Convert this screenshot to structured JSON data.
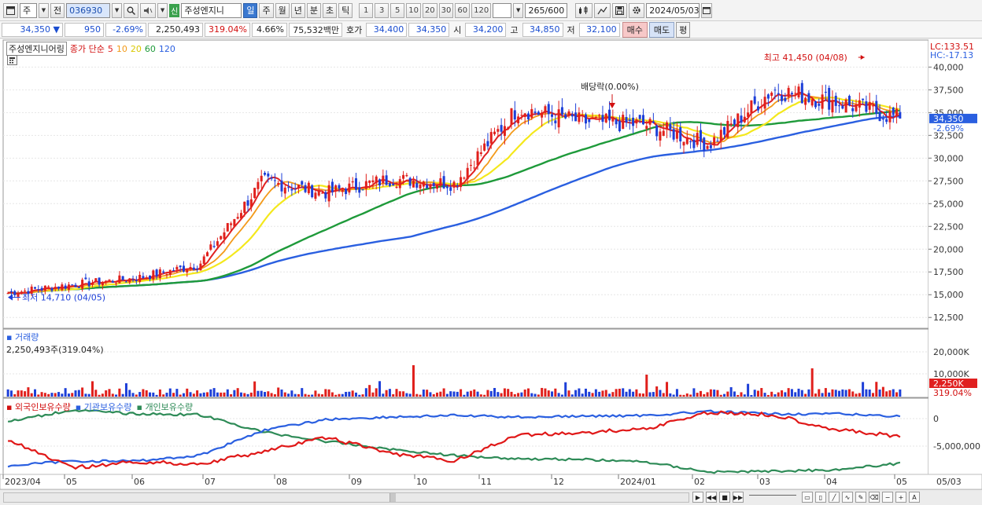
{
  "toolbar": {
    "market": "주",
    "prev": "전",
    "code": "036930",
    "badge": "신",
    "name": "주성엔지니",
    "periods": [
      "일",
      "주",
      "월",
      "년",
      "분",
      "초",
      "틱"
    ],
    "intervals": [
      "1",
      "3",
      "5",
      "10",
      "20",
      "30",
      "60",
      "120"
    ],
    "count": "265/600",
    "date": "2024/05/03"
  },
  "quote": {
    "price": "34,350 ▼",
    "change": "950",
    "change_pct": "-2.69%",
    "volume": "2,250,493",
    "volume_pct": "319.04%",
    "turnover": "4.66%",
    "amount": "75,532백만",
    "ask_label": "호가",
    "ask1": "34,400",
    "ask2": "34,350",
    "open_label": "시",
    "open": "34,200",
    "high_label": "고",
    "high": "34,850",
    "low_label": "저",
    "low": "32,100",
    "buy": "매수",
    "sell": "매도",
    "flat": "평"
  },
  "legend": {
    "name": "주성엔지니어링",
    "kind": "종가 단순",
    "ma": [
      "5",
      "10",
      "20",
      "60",
      "120"
    ]
  },
  "annotations": {
    "high": "최고 41,450 (04/08)",
    "low": "최저 14,710 (04/05)",
    "dividend": "배당락(0.00%)"
  },
  "price_axis": {
    "lc": "LC:133.51",
    "hc": "HC:-17.13",
    "ticks": [
      "40,000",
      "37,500",
      "35,000",
      "32,500",
      "30,000",
      "27,500",
      "25,000",
      "22,500",
      "20,000",
      "17,500",
      "15,000",
      "12,500"
    ],
    "current": "34,350",
    "current_pct": "-2.69%"
  },
  "volume_panel": {
    "title": "거래량",
    "value": "2,250,493주(319.04%)",
    "ticks": [
      "20,000K",
      "10,000K"
    ],
    "current": "2,250K",
    "current_pct": "319.04%"
  },
  "holdings_panel": {
    "series": [
      "외국인보유수량",
      "기관보유수량",
      "개인보유수량"
    ],
    "ticks": [
      "0",
      "-5,000,000"
    ]
  },
  "x_axis": [
    "2023/04",
    "05",
    "06",
    "07",
    "08",
    "09",
    "10",
    "11",
    "12",
    "2024/01",
    "02",
    "03",
    "04",
    "05",
    "05/03"
  ],
  "colors": {
    "up": "#e0201c",
    "down": "#1d3fd8",
    "ma5": "#e02020",
    "ma10": "#f39a1a",
    "ma20": "#f4e81c",
    "ma60": "#1e9a3a",
    "ma120": "#2a5fe0",
    "foreign": "#e01818",
    "institution": "#2a5fe0",
    "individual": "#2e8b57"
  },
  "chart_data": {
    "type": "candlestick",
    "price_key_points": [
      [
        "2023/04",
        15200
      ],
      [
        "2023/05",
        16100
      ],
      [
        "2023/06",
        16800
      ],
      [
        "2023/07",
        18300
      ],
      [
        "2023/08",
        27500
      ],
      [
        "2023/09",
        26200
      ],
      [
        "2023/10",
        27700
      ],
      [
        "2023/11",
        27200
      ],
      [
        "2023/11",
        35500
      ],
      [
        "2023/12",
        34000
      ],
      [
        "2024/01",
        33700
      ],
      [
        "2024/02",
        31500
      ],
      [
        "2024/03",
        37500
      ],
      [
        "2024/04",
        36200
      ],
      [
        "2024/05",
        34350
      ]
    ],
    "y_range": [
      12000,
      41500
    ]
  }
}
